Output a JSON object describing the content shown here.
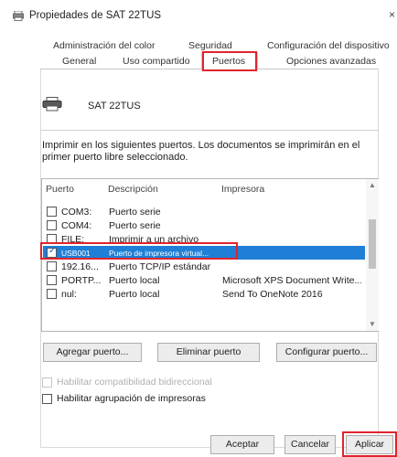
{
  "window": {
    "title": "Propiedades de SAT 22TUS",
    "close_glyph": "×",
    "icon": "printer-icon"
  },
  "tabs": {
    "row1": [
      "Administración del color",
      "Seguridad",
      "Configuración del dispositivo"
    ],
    "row2": [
      "General",
      "Uso compartido",
      "Puertos",
      "Opciones avanzadas"
    ],
    "active": "Puertos"
  },
  "printer": {
    "name": "SAT 22TUS",
    "icon": "printer-icon"
  },
  "instruction": "Imprimir en los siguientes puertos. Los documentos se imprimirán en el primer puerto libre seleccionado.",
  "port_list": {
    "headers": [
      "Puerto",
      "Descripción",
      "Impresora"
    ],
    "rows": [
      {
        "checked": false,
        "port": "COM3:",
        "description": "Puerto serie",
        "printer": ""
      },
      {
        "checked": false,
        "port": "COM4:",
        "description": "Puerto serie",
        "printer": ""
      },
      {
        "checked": false,
        "port": "FILE:",
        "description": "Imprimir a un archivo",
        "printer": ""
      },
      {
        "checked": true,
        "port": "USB001",
        "description": "Puerto de impresora virtual...",
        "printer": ""
      },
      {
        "checked": false,
        "port": "192.16...",
        "description": "Puerto TCP/IP estándar",
        "printer": ""
      },
      {
        "checked": false,
        "port": "PORTP...",
        "description": "Puerto local",
        "printer": "Microsoft XPS Document Write..."
      },
      {
        "checked": false,
        "port": "nul:",
        "description": "Puerto local",
        "printer": "Send To OneNote 2016"
      }
    ],
    "selected_port": "USB001"
  },
  "buttons": {
    "add_port": "Agregar puerto...",
    "delete_port": "Eliminar puerto",
    "configure_port": "Configurar puerto...",
    "accept": "Aceptar",
    "cancel": "Cancelar",
    "apply": "Aplicar"
  },
  "options": {
    "bidirectional": {
      "label": "Habilitar compatibilidad bidireccional",
      "checked": false,
      "enabled": false
    },
    "pooling": {
      "label": "Habilitar agrupación de impresoras",
      "checked": false,
      "enabled": true
    }
  },
  "colors": {
    "highlight_red": "#e0242c",
    "selection_blue": "#1f7fd6"
  }
}
